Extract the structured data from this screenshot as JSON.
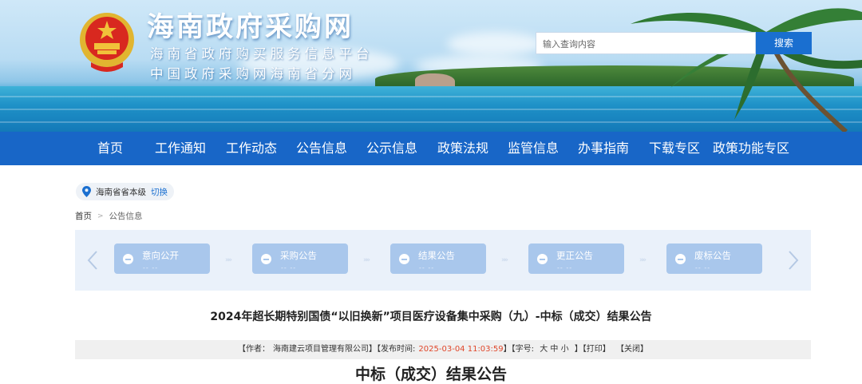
{
  "header": {
    "site_title": "海南政府采购网",
    "subtitle_1": "海南省政府购买服务信息平台",
    "subtitle_2": "中国政府采购网海南省分网",
    "search_placeholder": "输入查询内容",
    "search_button": "搜索"
  },
  "nav": {
    "items": [
      "首页",
      "工作通知",
      "工作动态",
      "公告信息",
      "公示信息",
      "政策法规",
      "监管信息",
      "办事指南",
      "下载专区",
      "政策功能专区"
    ]
  },
  "location": {
    "region": "海南省省本级",
    "switch_label": "切换"
  },
  "breadcrumb": {
    "home": "首页",
    "current": "公告信息"
  },
  "process": {
    "steps": [
      {
        "label": "意向公开",
        "sub": "-- --"
      },
      {
        "label": "采购公告",
        "sub": "-- --"
      },
      {
        "label": "结果公告",
        "sub": "-- --"
      },
      {
        "label": "更正公告",
        "sub": "-- --"
      },
      {
        "label": "废标公告",
        "sub": "-- --"
      }
    ]
  },
  "article": {
    "title": "2024年超长期特别国债“以旧换新”项目医疗设备集中采购（九）-中标（成交）结果公告",
    "meta": {
      "author_label": "【作者：",
      "author": "海南建云项目管理有限公司",
      "date_label": "】【发布时间:",
      "date": "2025-03-04 11:03:59",
      "font_label": "】【字号:",
      "size_large": "大",
      "size_medium": "中",
      "size_small": "小",
      "print": "】【打印】",
      "close": "【关闭】"
    },
    "heading": "中标（成交）结果公告"
  },
  "colors": {
    "nav_bg": "#1866c7",
    "search_button": "#1a6fd0",
    "step_bg": "#a9c7ec",
    "date_red": "#e0472b"
  },
  "icons": [
    "emblem-icon",
    "location-pin-icon",
    "chevron-left-icon",
    "chevron-right-icon",
    "minus-circle-icon"
  ]
}
